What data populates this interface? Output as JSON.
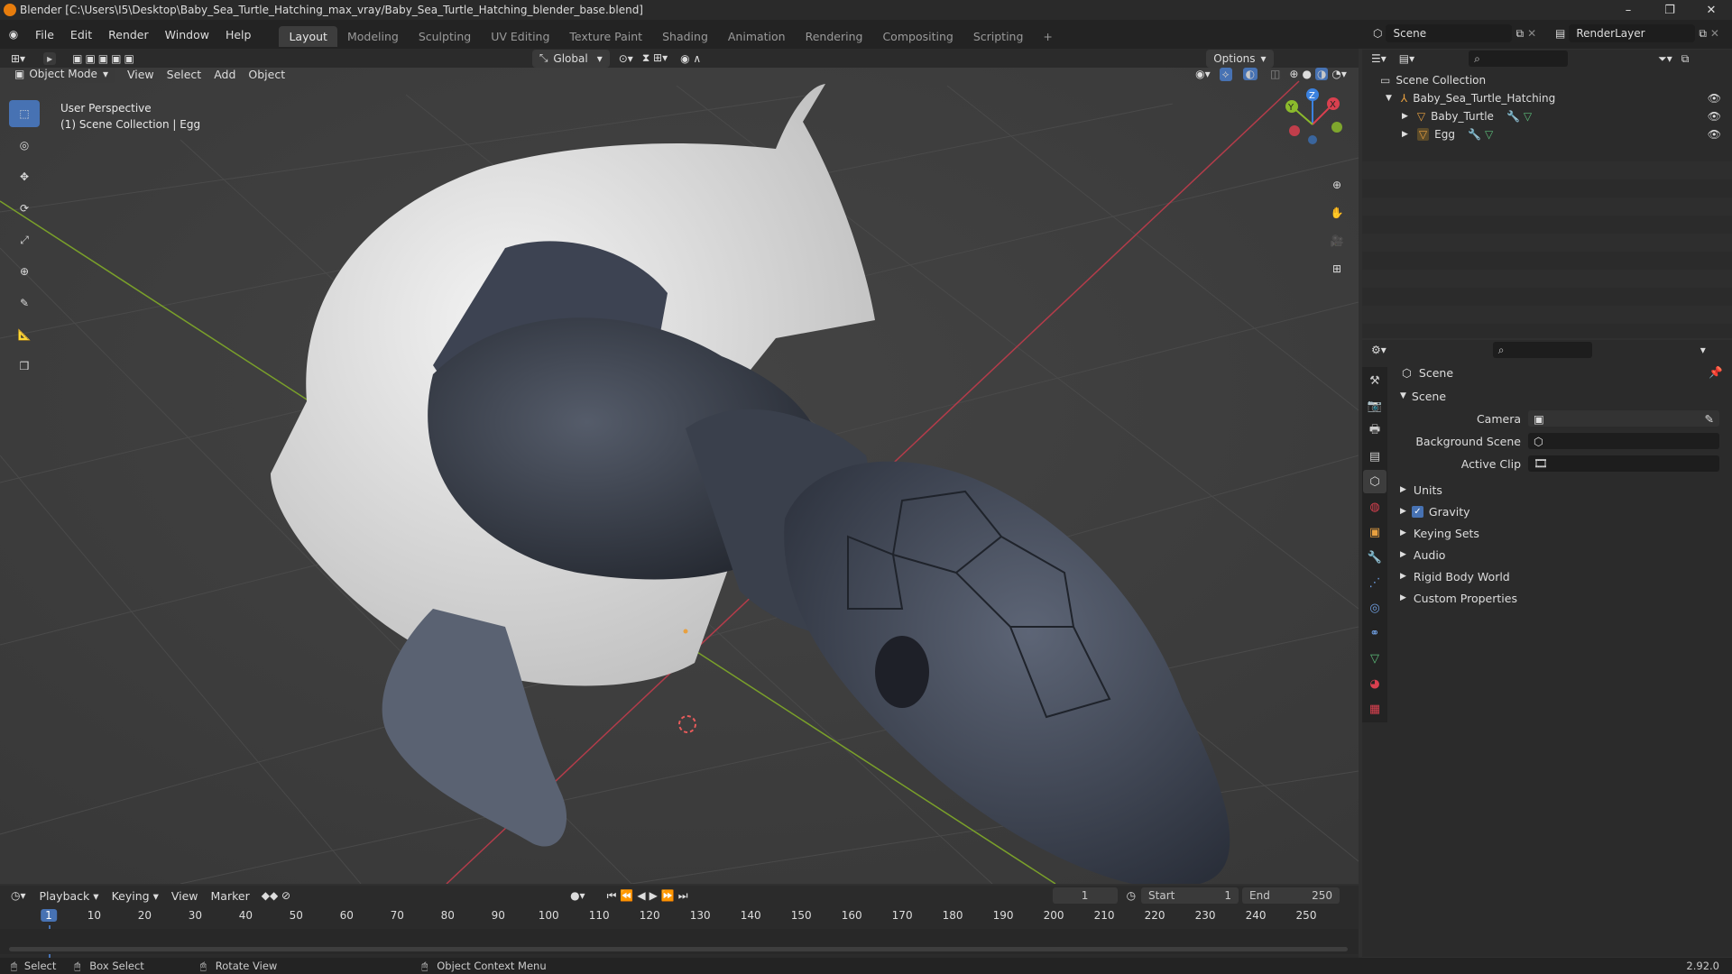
{
  "window": {
    "title": "Blender [C:\\Users\\I5\\Desktop\\Baby_Sea_Turtle_Hatching_max_vray/Baby_Sea_Turtle_Hatching_blender_base.blend]",
    "minimize": "–",
    "maximize": "❐",
    "close": "✕"
  },
  "menu": {
    "file": "File",
    "edit": "Edit",
    "render": "Render",
    "window": "Window",
    "help": "Help"
  },
  "workspaces": [
    "Layout",
    "Modeling",
    "Sculpting",
    "UV Editing",
    "Texture Paint",
    "Shading",
    "Animation",
    "Rendering",
    "Compositing",
    "Scripting"
  ],
  "add_workspace": "+",
  "top": {
    "scene_label": "Scene",
    "renderlayer_label": "RenderLayer"
  },
  "viewport_header": {
    "mode": "Object Mode",
    "view": "View",
    "select": "Select",
    "add": "Add",
    "object": "Object",
    "orientation": "Global",
    "options": "Options"
  },
  "viewport": {
    "perspective": "User Perspective",
    "collection_info": "(1) Scene Collection | Egg",
    "gizmo": {
      "x": "X",
      "y": "Y",
      "z": "Z"
    }
  },
  "outliner": {
    "root": "Scene Collection",
    "items": [
      {
        "name": "Baby_Sea_Turtle_Hatching"
      },
      {
        "name": "Baby_Turtle"
      },
      {
        "name": "Egg"
      }
    ]
  },
  "properties": {
    "header": "Scene",
    "panel": "Scene",
    "camera_label": "Camera",
    "bg_scene_label": "Background Scene",
    "active_clip_label": "Active Clip",
    "subpanels": [
      "Units",
      "Gravity",
      "Keying Sets",
      "Audio",
      "Rigid Body World",
      "Custom Properties"
    ],
    "gravity_checked": true
  },
  "timeline": {
    "playback": "Playback",
    "keying": "Keying",
    "view": "View",
    "marker": "Marker",
    "current_frame": "1",
    "start_label": "Start",
    "start": "1",
    "end_label": "End",
    "end": "250",
    "ticks": [
      "1",
      "10",
      "20",
      "30",
      "40",
      "50",
      "60",
      "70",
      "80",
      "90",
      "100",
      "110",
      "120",
      "130",
      "140",
      "150",
      "160",
      "170",
      "180",
      "190",
      "200",
      "210",
      "220",
      "230",
      "240",
      "250"
    ]
  },
  "statusbar": {
    "select": "Select",
    "box_select": "Box Select",
    "rotate_view": "Rotate View",
    "context_menu": "Object Context Menu",
    "version": "2.92.0"
  },
  "colors": {
    "accent": "#4772b3",
    "x_axis": "#d9404f",
    "y_axis": "#8bba2c",
    "z_axis": "#3b82e0"
  }
}
